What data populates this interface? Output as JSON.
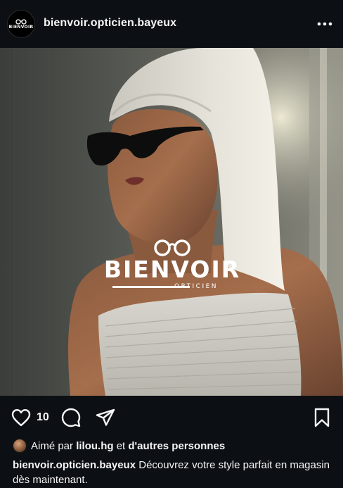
{
  "header": {
    "username": "bienvoir.opticien.bayeux",
    "avatar_brand": "BIENVOIR",
    "more_icon": "more-horizontal-icon"
  },
  "post": {
    "logo_brand": "BIENVOIR",
    "logo_subtitle": "OPTICIEN"
  },
  "actions": {
    "like_icon": "heart-icon",
    "like_count": "10",
    "comment_icon": "comment-icon",
    "share_icon": "send-icon",
    "save_icon": "bookmark-icon"
  },
  "likes": {
    "prefix": "Aimé par",
    "user": "lilou.hg",
    "connector": "et",
    "others": "d'autres personnes"
  },
  "caption": {
    "username": "bienvoir.opticien.bayeux",
    "text": "Découvrez votre style parfait en magasin dès maintenant."
  },
  "colors": {
    "background": "#0c1014",
    "text": "#f5f5f5"
  }
}
